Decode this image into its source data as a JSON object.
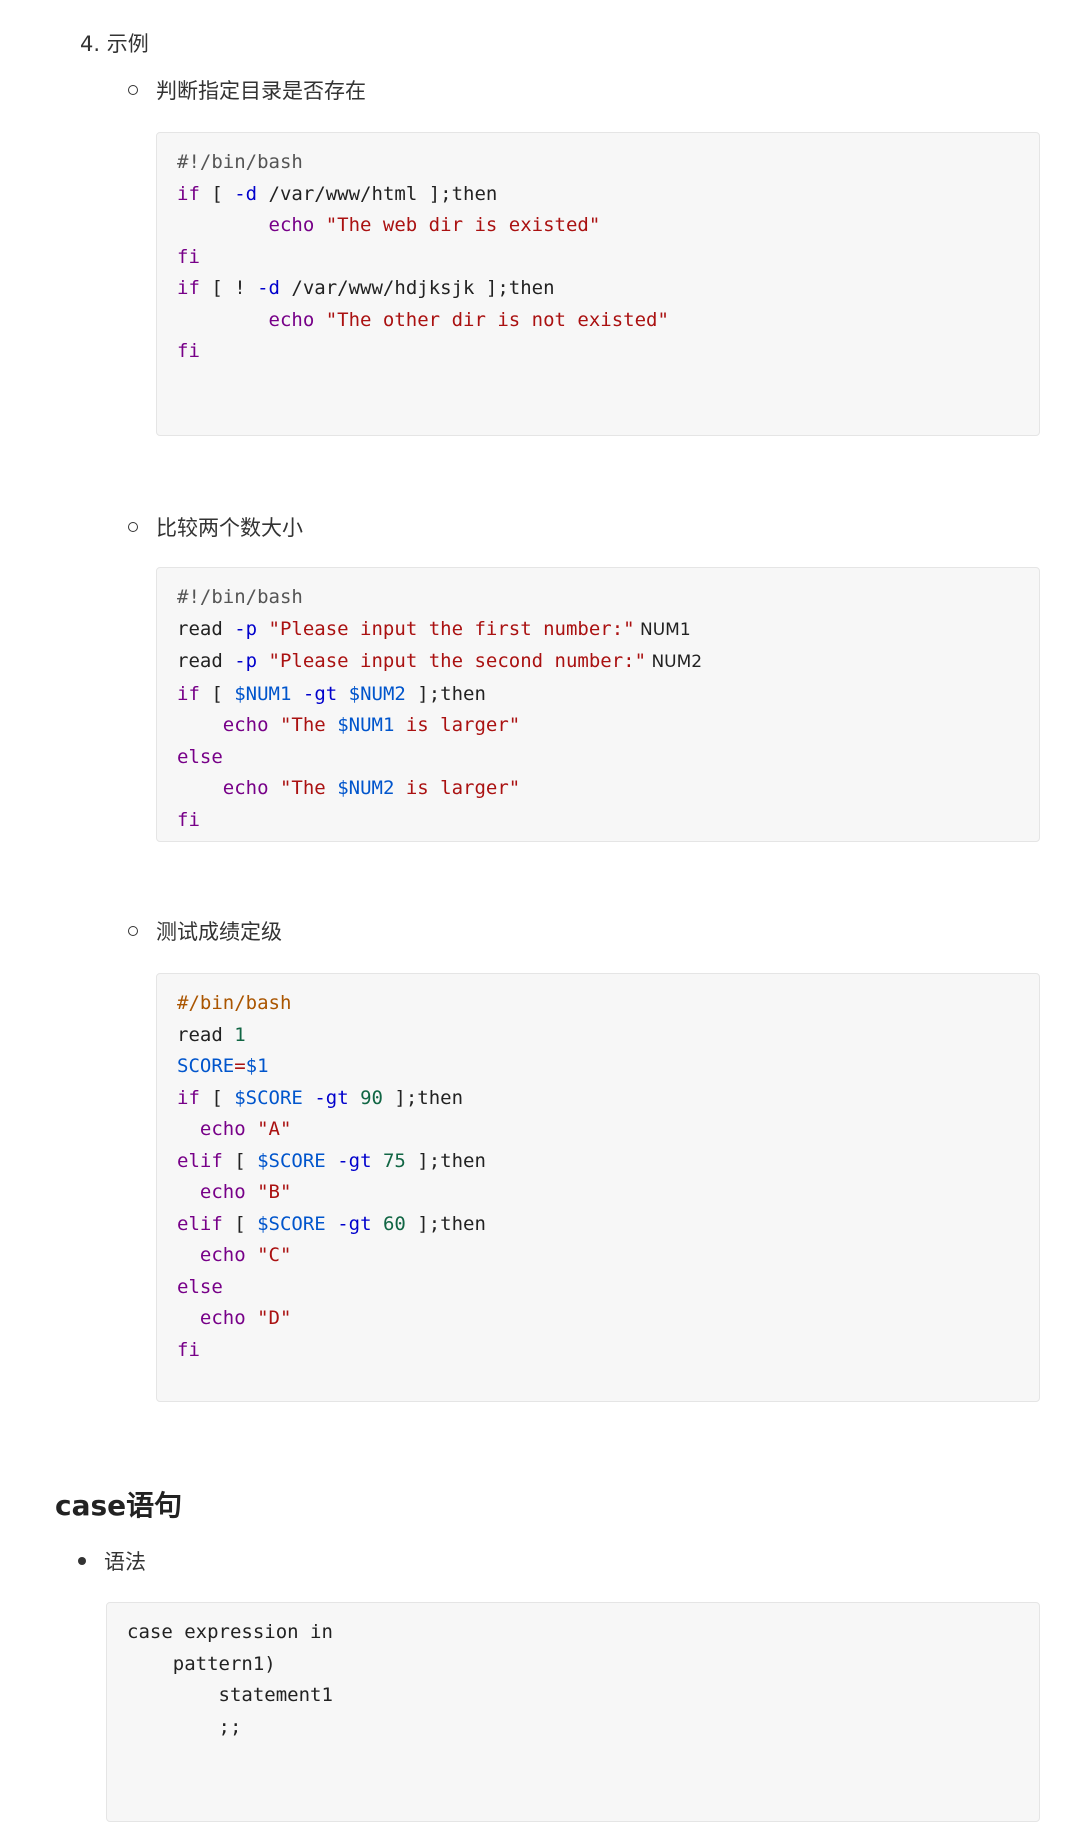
{
  "section_item": "4. 示例",
  "examples": [
    {
      "title": "判断指定目录是否存在",
      "lines": [
        [
          [
            "c",
            "#!/bin/bash"
          ]
        ],
        [
          [
            "k",
            "if"
          ],
          [
            "p",
            " [ "
          ],
          [
            "b",
            "-d"
          ],
          [
            "p",
            " /var/www/html ];then"
          ]
        ],
        [
          [
            "p",
            "        "
          ],
          [
            "k",
            "echo"
          ],
          [
            "p",
            " "
          ],
          [
            "s",
            "\"The web dir is existed\""
          ]
        ],
        [
          [
            "k",
            "fi"
          ]
        ],
        [
          [
            "k",
            "if"
          ],
          [
            "p",
            " [ ! "
          ],
          [
            "b",
            "-d"
          ],
          [
            "p",
            " /var/www/hdjksjk ];then"
          ]
        ],
        [
          [
            "p",
            "        "
          ],
          [
            "k",
            "echo"
          ],
          [
            "p",
            " "
          ],
          [
            "s",
            "\"The other dir is not existed\""
          ]
        ],
        [
          [
            "k",
            "fi"
          ]
        ],
        [
          [
            "p",
            " "
          ]
        ],
        [
          [
            "p",
            " "
          ]
        ]
      ]
    },
    {
      "title": "比较两个数大小",
      "lines": [
        [
          [
            "c",
            "#!/bin/bash"
          ]
        ],
        [
          [
            "p",
            "read "
          ],
          [
            "b",
            "-p"
          ],
          [
            "p",
            " "
          ],
          [
            "s",
            "\"Please input the first number:\""
          ],
          [
            "sm",
            " NUM1"
          ]
        ],
        [
          [
            "p",
            "read "
          ],
          [
            "b",
            "-p"
          ],
          [
            "p",
            " "
          ],
          [
            "s",
            "\"Please input the second number:\""
          ],
          [
            "sm",
            " NUM2"
          ]
        ],
        [
          [
            "k",
            "if"
          ],
          [
            "p",
            " [ "
          ],
          [
            "v",
            "$NUM1"
          ],
          [
            "p",
            " "
          ],
          [
            "b",
            "-gt"
          ],
          [
            "p",
            " "
          ],
          [
            "v",
            "$NUM2"
          ],
          [
            "p",
            " ];then"
          ]
        ],
        [
          [
            "p",
            "    "
          ],
          [
            "k",
            "echo"
          ],
          [
            "p",
            " "
          ],
          [
            "s",
            "\"The "
          ],
          [
            "v",
            "$NUM1"
          ],
          [
            "s",
            " is larger\""
          ]
        ],
        [
          [
            "k",
            "else"
          ]
        ],
        [
          [
            "p",
            "    "
          ],
          [
            "k",
            "echo"
          ],
          [
            "p",
            " "
          ],
          [
            "s",
            "\"The "
          ],
          [
            "v",
            "$NUM2"
          ],
          [
            "s",
            " is larger\""
          ]
        ],
        [
          [
            "k",
            "fi"
          ]
        ]
      ]
    },
    {
      "title": "测试成绩定级",
      "lines": [
        [
          [
            "o",
            "#/bin/bash"
          ]
        ],
        [
          [
            "p",
            "read "
          ],
          [
            "n",
            "1"
          ]
        ],
        [
          [
            "v",
            "SCORE"
          ],
          [
            "s",
            "="
          ],
          [
            "v",
            "$1"
          ]
        ],
        [
          [
            "k",
            "if"
          ],
          [
            "p",
            " [ "
          ],
          [
            "v",
            "$SCORE"
          ],
          [
            "p",
            " "
          ],
          [
            "b",
            "-gt"
          ],
          [
            "p",
            " "
          ],
          [
            "n",
            "90"
          ],
          [
            "p",
            " ];then"
          ]
        ],
        [
          [
            "p",
            "  "
          ],
          [
            "k",
            "echo"
          ],
          [
            "p",
            " "
          ],
          [
            "s",
            "\"A\""
          ]
        ],
        [
          [
            "k",
            "elif"
          ],
          [
            "p",
            " [ "
          ],
          [
            "v",
            "$SCORE"
          ],
          [
            "p",
            " "
          ],
          [
            "b",
            "-gt"
          ],
          [
            "p",
            " "
          ],
          [
            "n",
            "75"
          ],
          [
            "p",
            " ];then"
          ]
        ],
        [
          [
            "p",
            "  "
          ],
          [
            "k",
            "echo"
          ],
          [
            "p",
            " "
          ],
          [
            "s",
            "\"B\""
          ]
        ],
        [
          [
            "k",
            "elif"
          ],
          [
            "p",
            " [ "
          ],
          [
            "v",
            "$SCORE"
          ],
          [
            "p",
            " "
          ],
          [
            "b",
            "-gt"
          ],
          [
            "p",
            " "
          ],
          [
            "n",
            "60"
          ],
          [
            "p",
            " ];then"
          ]
        ],
        [
          [
            "p",
            "  "
          ],
          [
            "k",
            "echo"
          ],
          [
            "p",
            " "
          ],
          [
            "s",
            "\"C\""
          ]
        ],
        [
          [
            "k",
            "else"
          ]
        ],
        [
          [
            "p",
            "  "
          ],
          [
            "k",
            "echo"
          ],
          [
            "p",
            " "
          ],
          [
            "s",
            "\"D\""
          ]
        ],
        [
          [
            "k",
            "fi"
          ]
        ],
        [
          [
            "p",
            " "
          ]
        ]
      ]
    }
  ],
  "case_heading": "case语句",
  "syntax_label": "语法",
  "syntax_code": {
    "lines": [
      [
        [
          "p",
          "case expression in"
        ]
      ],
      [
        [
          "p",
          "    pattern1)"
        ]
      ],
      [
        [
          "p",
          "        statement1"
        ]
      ],
      [
        [
          "p",
          "        ;;"
        ]
      ],
      [
        [
          "p",
          " "
        ]
      ],
      [
        [
          "p",
          " "
        ]
      ]
    ]
  }
}
